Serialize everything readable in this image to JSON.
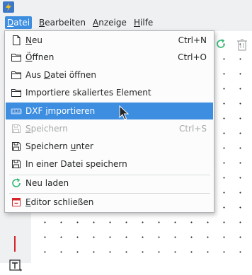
{
  "menubar": {
    "items": [
      {
        "label": "Datei",
        "mnemonic": "D",
        "rest": "atei",
        "active": true
      },
      {
        "label": "Bearbeiten",
        "mnemonic": "B",
        "rest": "earbeiten",
        "active": false
      },
      {
        "label": "Anzeige",
        "mnemonic": "A",
        "rest": "nzeige",
        "active": false
      },
      {
        "label": "Hilfe",
        "mnemonic": "H",
        "rest": "ilfe",
        "active": false
      }
    ]
  },
  "file_menu": {
    "items": [
      {
        "pre": "",
        "mnem": "N",
        "post": "eu",
        "shortcut": "Ctrl+N",
        "icon": "new-document-icon",
        "state": "normal"
      },
      {
        "pre": "",
        "mnem": "Ö",
        "post": "ffnen",
        "shortcut": "Ctrl+O",
        "icon": "folder-open-icon",
        "state": "normal"
      },
      {
        "pre": "Aus ",
        "mnem": "D",
        "post": "atei öffnen",
        "shortcut": "",
        "icon": "folder-icon",
        "state": "normal"
      },
      {
        "pre": "Importiere skaliertes Element",
        "mnem": "",
        "post": "",
        "shortcut": "",
        "icon": "folder-icon",
        "state": "normal"
      },
      {
        "pre": "DXF ",
        "mnem": "i",
        "post": "mportieren",
        "shortcut": "",
        "icon": "dxf-icon",
        "state": "highlight"
      },
      {
        "pre": "",
        "mnem": "S",
        "post": "peichern",
        "shortcut": "Ctrl+S",
        "icon": "save-icon",
        "state": "disabled"
      },
      {
        "pre": "Speichern ",
        "mnem": "u",
        "post": "nter",
        "shortcut": "",
        "icon": "save-as-icon",
        "state": "normal"
      },
      {
        "pre": "In einer Datei speichern",
        "mnem": "",
        "post": "",
        "shortcut": "",
        "icon": "save-copy-icon",
        "state": "normal"
      },
      {
        "pre": "Neu laden",
        "mnem": "",
        "post": "",
        "shortcut": "",
        "icon": "reload-icon",
        "state": "normal"
      },
      {
        "pre": "",
        "mnem": "E",
        "post": "ditor schließen",
        "shortcut": "",
        "icon": "close-window-icon",
        "state": "normal"
      }
    ]
  },
  "colors": {
    "highlight": "#3d8ee0",
    "menubar_bg": "#eff0f1",
    "disabled_text": "#a6a8ab",
    "reload_green": "#2eb872",
    "close_red": "#d6262a"
  }
}
